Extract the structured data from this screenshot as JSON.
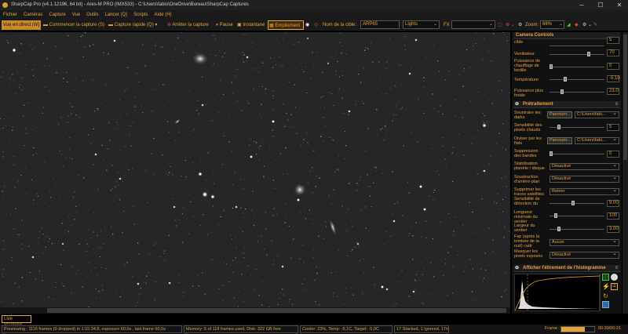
{
  "window": {
    "title": "SharpCap Pro (v4.1.12196, 64 bit) - Ares-M PRO (IMX533) - C:\\Users\\fabio\\OneDrive\\Bureau\\SharpCap Captures",
    "min": "─",
    "max": "☐",
    "close": "✕"
  },
  "menu": [
    "Fichier",
    "Caméras",
    "Capture",
    "Vue",
    "Outils",
    "Lancer (Q)",
    "Scripts",
    "Aide (H)"
  ],
  "toolbar": {
    "live": "Vue en direct (W)",
    "start_capture": "Commencer la capture (S)",
    "quick_capture": "Capture rapide (Q)",
    "stop_capture": "Arrêter la capture",
    "pause": "Pause",
    "snapshot": "Instantané",
    "stacking": "Empilement",
    "target_label": "Nom de la cible:",
    "target_value": "ARP65",
    "frame_type": "Lights",
    "fx_label": "FX",
    "fx_value": "",
    "zoom_label": "Zoom:",
    "zoom_value": "66%"
  },
  "panel": {
    "camera_controls": "Camera Controls",
    "cc": [
      {
        "label": "cible",
        "value": "5"
      },
      {
        "label": "Ventilateur",
        "value": "70"
      },
      {
        "label": "Puissance de chauffage de lentille",
        "value": "0"
      },
      {
        "label": "Température",
        "value": "-5.10"
      },
      {
        "label": "Puissance plus froide",
        "value": "23.0"
      }
    ],
    "pretraitement": "Prétraitement",
    "pt": {
      "darks": {
        "label": "Soustraire les darks",
        "btn": "Parcourir...",
        "path": "C:\\Users\\fabi..."
      },
      "hot": {
        "label": "Sensibilité des pixels chauds",
        "value": "5"
      },
      "flats": {
        "label": "Diviser par les flats",
        "btn": "Parcourir...",
        "path": "C:\\Users\\fabi..."
      },
      "bands": {
        "label": "Suppression des bandes",
        "value": "0"
      },
      "stab": {
        "label": "Stabilisation planète / disque",
        "value": "Désactivé"
      },
      "bg": {
        "label": "Soustraction d'arrière-plan",
        "value": "Désactivé"
      },
      "sat": {
        "label": "Supprimer les traces satellites",
        "value": "Retirer"
      },
      "sens": {
        "label": "Sensibilité de détection du",
        "value": "9.00"
      },
      "minlen": {
        "label": "Longueur minimale du sentier",
        "value": "100"
      },
      "width": {
        "label": "Largeur du sentier",
        "value": "3.00"
      },
      "frames": {
        "label": "Fsp (après la tombée de la nuit) cadr",
        "value": "Aucun"
      },
      "mask": {
        "label": "Masquer les pixels exposés",
        "value": "Désactivé"
      }
    },
    "histogram": "Afficher l'étirement de l'histogramme"
  },
  "live_stacking": "Live Stacking",
  "status": {
    "preview": "Previewing : 1116 frames (0 dropped) in 1:15:34,8, exposure 60,0s , last frame 60,0s",
    "memory": "Memory: 5 of 118 frames used, Disk: 322 GB free",
    "cooler": "Cooler: 23%, Temp: -5,1C, Target: -5,0C",
    "stacked": "17 Stacked, 1 Ignored, 17m 0s",
    "frame_label": "Frame :",
    "frame_progress": 0.72,
    "time": "00:39/00:21"
  },
  "colors": {
    "accent": "#e8a43c",
    "bg": "#1a1a1a"
  }
}
